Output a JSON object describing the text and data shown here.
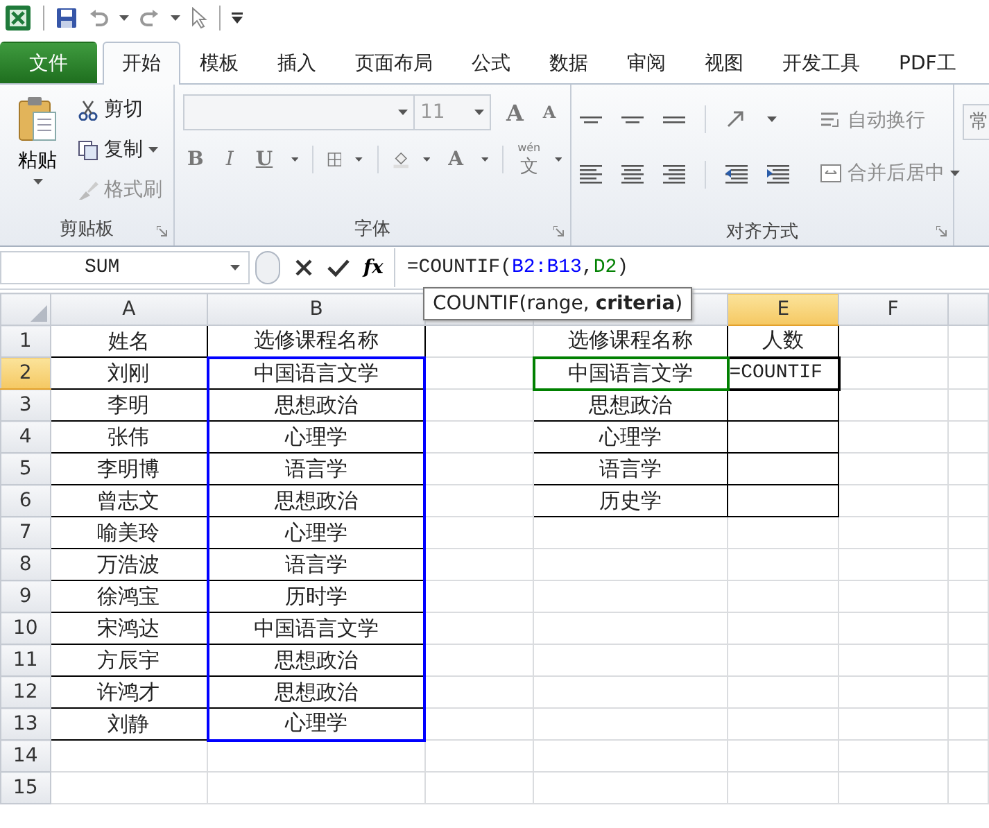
{
  "tabs": [
    {
      "label": "文件",
      "kind": "file",
      "selected": false
    },
    {
      "label": "开始",
      "kind": "tab",
      "selected": true
    },
    {
      "label": "模板",
      "kind": "tab",
      "selected": false
    },
    {
      "label": "插入",
      "kind": "tab",
      "selected": false
    },
    {
      "label": "页面布局",
      "kind": "tab",
      "selected": false
    },
    {
      "label": "公式",
      "kind": "tab",
      "selected": false
    },
    {
      "label": "数据",
      "kind": "tab",
      "selected": false
    },
    {
      "label": "审阅",
      "kind": "tab",
      "selected": false
    },
    {
      "label": "视图",
      "kind": "tab",
      "selected": false
    },
    {
      "label": "开发工具",
      "kind": "tab",
      "selected": false
    },
    {
      "label": "PDF工",
      "kind": "tab",
      "selected": false
    }
  ],
  "ribbon": {
    "groups": [
      {
        "kind": "clipboard",
        "label": "剪贴板",
        "paste": "粘贴",
        "commands": [
          {
            "label": "剪切",
            "disabled": false,
            "dropdown": false
          },
          {
            "label": "复制",
            "disabled": false,
            "dropdown": true
          },
          {
            "label": "格式刷",
            "disabled": true,
            "dropdown": false
          }
        ]
      },
      {
        "kind": "font",
        "label": "字体",
        "font_size": "11",
        "grow": "A",
        "shrink": "A",
        "styles": [
          "B",
          "I",
          "U"
        ],
        "font_color": "A",
        "phonetic_top": "wén",
        "phonetic": "文"
      },
      {
        "kind": "alignment",
        "label": "对齐方式",
        "commands": [
          {
            "label": "自动换行",
            "disabled": true
          },
          {
            "label": "合并后居中",
            "disabled": true
          }
        ]
      },
      {
        "kind": "number",
        "label": "常"
      }
    ]
  },
  "formula_bar": {
    "name_box": "SUM",
    "function_button": "fx",
    "formula": [
      {
        "text": "=COUNTIF("
      },
      {
        "text": "B2:B13",
        "color": "#0000ff"
      },
      {
        "text": ","
      },
      {
        "text": "D2",
        "color": "#008000"
      },
      {
        "text": ")"
      }
    ],
    "tooltip": "COUNTIF(range, **criteria**)"
  },
  "columns": [
    {
      "label": "A",
      "selected": false
    },
    {
      "label": "B",
      "selected": false
    },
    {
      "selected": false
    },
    {
      "selected": false
    },
    {
      "label": "E",
      "selected": true
    },
    {
      "label": "F",
      "selected": false
    }
  ],
  "rows": [
    {
      "header": "1",
      "selected": false,
      "a": {
        "text": "姓名"
      },
      "b": {
        "text": "选修课程名称"
      },
      "d": {
        "text": "选修课程名称"
      },
      "e": {
        "text": "人数"
      }
    },
    {
      "header": "2",
      "selected": true,
      "a": {
        "text": "刘刚"
      },
      "b": {
        "text": "中国语言文学",
        "color": "#0000ff"
      },
      "d": {
        "text": "中国语言文学",
        "color": "#008000"
      },
      "e": {
        "text": "=COUNTIF",
        "editing": true
      }
    },
    {
      "header": "3",
      "selected": false,
      "a": {
        "text": "李明"
      },
      "b": {
        "text": "思想政治",
        "color": "#0000ff"
      },
      "d": {
        "text": "思想政治"
      }
    },
    {
      "header": "4",
      "selected": false,
      "a": {
        "text": "张伟"
      },
      "b": {
        "text": "心理学",
        "color": "#0000ff"
      },
      "d": {
        "text": "心理学"
      }
    },
    {
      "header": "5",
      "selected": false,
      "a": {
        "text": "李明博"
      },
      "b": {
        "text": "语言学",
        "color": "#0000ff"
      },
      "d": {
        "text": "语言学"
      }
    },
    {
      "header": "6",
      "selected": false,
      "a": {
        "text": "曾志文"
      },
      "b": {
        "text": "思想政治",
        "color": "#0000ff"
      },
      "d": {
        "text": "历史学"
      }
    },
    {
      "header": "7",
      "selected": false,
      "a": {
        "text": "喻美玲"
      },
      "b": {
        "text": "心理学",
        "color": "#0000ff"
      }
    },
    {
      "header": "8",
      "selected": false,
      "a": {
        "text": "万浩波"
      },
      "b": {
        "text": "语言学",
        "color": "#0000ff"
      }
    },
    {
      "header": "9",
      "selected": false,
      "a": {
        "text": "徐鸿宝"
      },
      "b": {
        "text": "历时学",
        "color": "#0000ff"
      }
    },
    {
      "header": "10",
      "selected": false,
      "a": {
        "text": "宋鸿达"
      },
      "b": {
        "text": "中国语言文学",
        "color": "#0000ff"
      }
    },
    {
      "header": "11",
      "selected": false,
      "a": {
        "text": "方辰宇"
      },
      "b": {
        "text": "思想政治",
        "color": "#0000ff"
      }
    },
    {
      "header": "12",
      "selected": false,
      "a": {
        "text": "许鸿才"
      },
      "b": {
        "text": "思想政治",
        "color": "#0000ff"
      }
    },
    {
      "header": "13",
      "selected": false,
      "a": {
        "text": "刘静"
      },
      "b": {
        "text": "心理学",
        "color": "#0000ff"
      }
    },
    {
      "header": "14",
      "selected": false
    },
    {
      "header": "15",
      "selected": false
    }
  ]
}
